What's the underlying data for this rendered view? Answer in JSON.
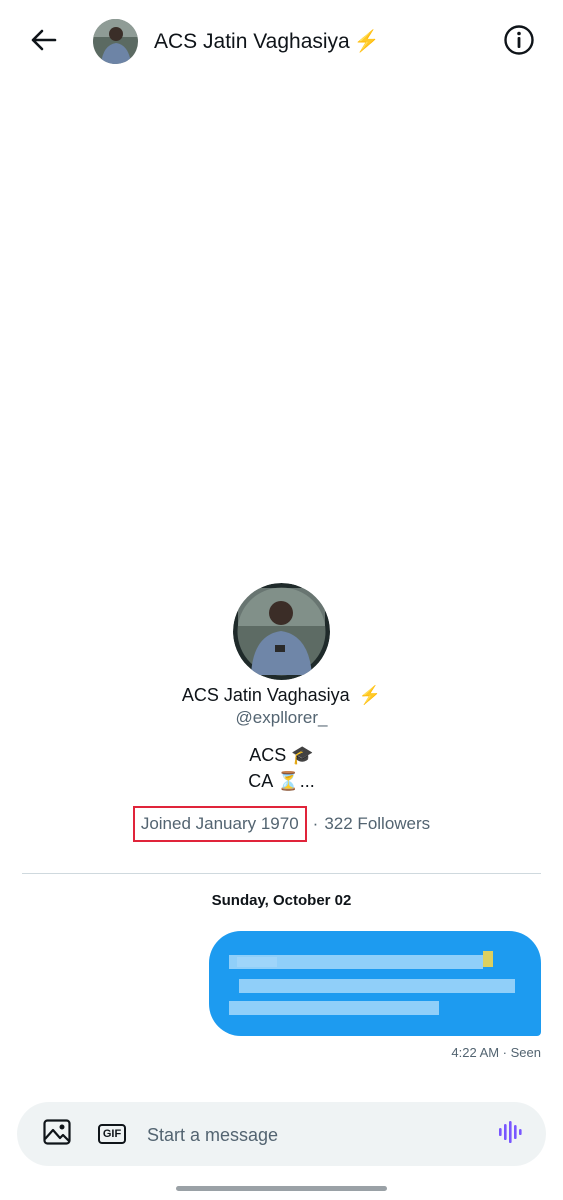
{
  "header": {
    "title": "ACS Jatin Vaghasiya",
    "title_emoji": "⚡",
    "back_icon": "arrow-left-icon",
    "info_icon": "info-icon"
  },
  "profile": {
    "name": "ACS Jatin Vaghasiya",
    "name_emoji": "⚡",
    "handle": "@expllorer_",
    "bio_line1": "ACS 🎓",
    "bio_line2": "CA ⏳...",
    "joined": "Joined January 1970",
    "separator": "·",
    "followers": "322 Followers"
  },
  "conversation": {
    "date": "Sunday, October 02",
    "message_status": "4:22 AM · Seen",
    "bubble_color": "#1d9bf0"
  },
  "composer": {
    "placeholder": "Start a message",
    "gif_label": "GIF",
    "image_icon": "image-icon",
    "voice_icon": "voice-waveform-icon",
    "accent_color": "#7856ff"
  }
}
